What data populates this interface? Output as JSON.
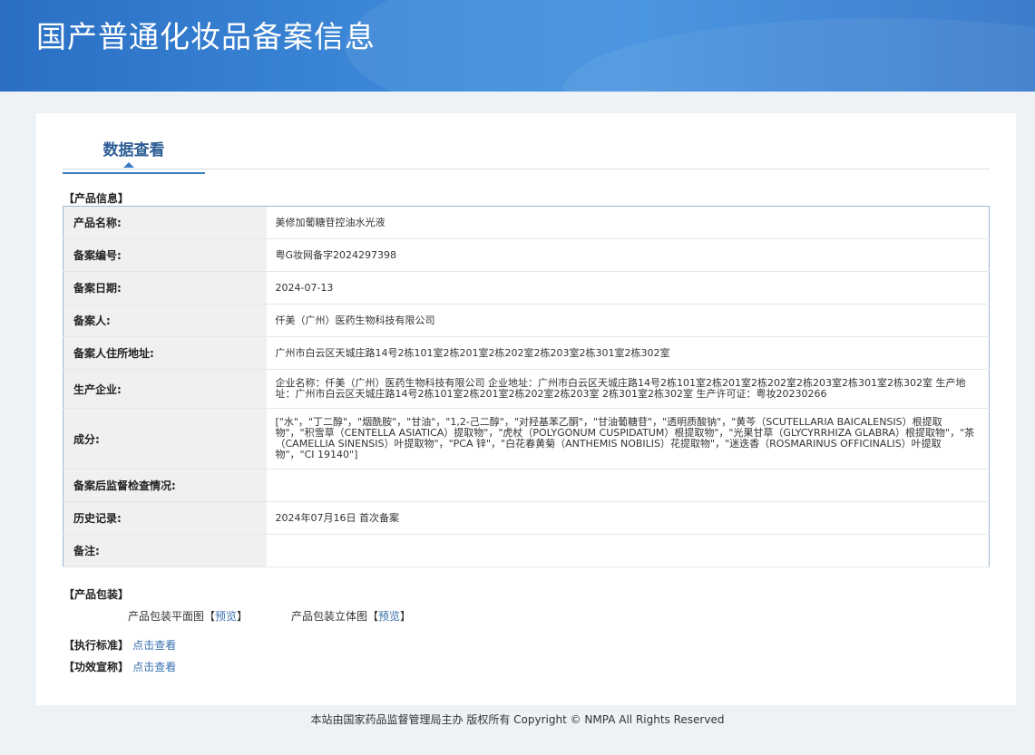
{
  "header": {
    "title": "国产普通化妆品备案信息"
  },
  "tab": {
    "label": "数据查看"
  },
  "product_info": {
    "section_label": "【产品信息】",
    "rows": [
      {
        "key": "产品名称:",
        "value": "美修加葡糖苷控油水光液"
      },
      {
        "key": "备案编号:",
        "value": "粤G妆网备字2024297398"
      },
      {
        "key": "备案日期:",
        "value": "2024-07-13"
      },
      {
        "key": "备案人:",
        "value": "仟美（广州）医药生物科技有限公司"
      },
      {
        "key": "备案人住所地址:",
        "value": "广州市白云区天城庄路14号2栋101室2栋201室2栋202室2栋203室2栋301室2栋302室"
      },
      {
        "key": "生产企业:",
        "value": "企业名称：仟美（广州）医药生物科技有限公司 企业地址：广州市白云区天城庄路14号2栋101室2栋201室2栋202室2栋203室2栋301室2栋302室 生产地址：广州市白云区天城庄路14号2栋101室2栋201室2栋202室2栋203室 2栋301室2栋302室 生产许可证：粤妆20230266"
      },
      {
        "key": "成分:",
        "value": "[\"水\"，\"丁二醇\"，\"烟酰胺\"，\"甘油\"，\"1,2-己二醇\"，\"对羟基苯乙酮\"，\"甘油葡糖苷\"，\"透明质酸钠\"，\"黄芩（SCUTELLARIA BAICALENSIS）根提取物\"，\"积雪草（CENTELLA ASIATICA）提取物\"，\"虎杖（POLYGONUM CUSPIDATUM）根提取物\"，\"光果甘草（GLYCYRRHIZA GLABRA）根提取物\"，\"茶（CAMELLIA SINENSIS）叶提取物\"，\"PCA 锌\"，\"白花春黄菊（ANTHEMIS NOBILIS）花提取物\"，\"迷迭香（ROSMARINUS OFFICINALIS）叶提取物\"，\"CI 19140\"]"
      },
      {
        "key": "备案后监督检查情况:",
        "value": ""
      },
      {
        "key": "历史记录:",
        "value": "2024年07月16日 首次备案"
      },
      {
        "key": "备注:",
        "value": ""
      }
    ]
  },
  "packaging": {
    "section_label": "【产品包装】",
    "flat_label": "产品包装平面图",
    "flat_link": "预览",
    "solid_label": "产品包装立体图",
    "solid_link": "预览",
    "bracket_open": "【",
    "bracket_close": "】"
  },
  "standard": {
    "label": "【执行标准】",
    "link": "点击查看"
  },
  "efficacy": {
    "label": "【功效宣称】",
    "link": "点击查看"
  },
  "footer": {
    "text": "本站由国家药品监督管理局主办 版权所有 Copyright © NMPA All Rights Reserved"
  }
}
